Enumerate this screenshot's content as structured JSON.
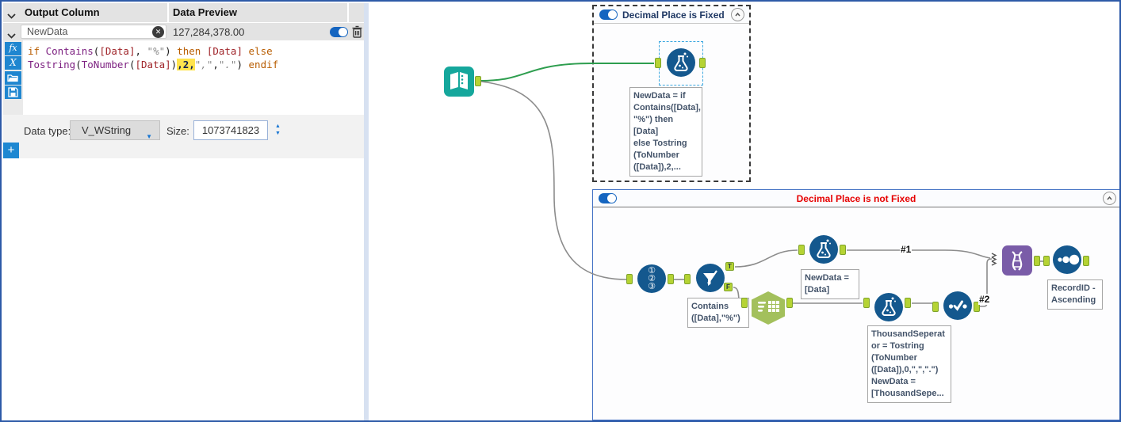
{
  "left_panel": {
    "header": {
      "output_column": "Output Column",
      "data_preview": "Data Preview"
    },
    "field_row": {
      "name": "NewData",
      "preview": "127,284,378.00",
      "clear_glyph": "✕"
    },
    "formula": {
      "line1": [
        {
          "t": "if ",
          "c": "kw"
        },
        {
          "t": "Contains",
          "c": "fn"
        },
        {
          "t": "(",
          "c": "pl"
        },
        {
          "t": "[Data]",
          "c": "fld"
        },
        {
          "t": ", ",
          "c": "pl"
        },
        {
          "t": "\"%\"",
          "c": "str"
        },
        {
          "t": ") ",
          "c": "pl"
        },
        {
          "t": "then",
          "c": "kw"
        },
        {
          "t": " ",
          "c": "pl"
        },
        {
          "t": "[Data]",
          "c": "fld"
        },
        {
          "t": " ",
          "c": "pl"
        },
        {
          "t": "else",
          "c": "kw"
        }
      ],
      "line2": [
        {
          "t": "Tostring",
          "c": "fn"
        },
        {
          "t": "(",
          "c": "pl"
        },
        {
          "t": "ToNumber",
          "c": "fn"
        },
        {
          "t": "(",
          "c": "pl"
        },
        {
          "t": "[Data]",
          "c": "fld"
        },
        {
          "t": ")",
          "c": "pl"
        },
        {
          "t": ",2,",
          "c": "hl"
        },
        {
          "t": "\",\"",
          "c": "str"
        },
        {
          "t": ",",
          "c": "pl"
        },
        {
          "t": "\".\"",
          "c": "str"
        },
        {
          "t": ")",
          "c": "pl"
        },
        {
          "t": " ",
          "c": "pl"
        },
        {
          "t": "endif",
          "c": "kw"
        }
      ]
    },
    "toolbar": {
      "fx_glyph": "fx",
      "x_glyph": "X",
      "add_glyph": "+"
    },
    "footer": {
      "data_type_label": "Data type:",
      "data_type_value": "V_WString",
      "size_label": "Size:",
      "size_value": "1073741823",
      "dropdown_arrow": "▼",
      "spin_up": "▲",
      "spin_down": "▼"
    }
  },
  "canvas": {
    "container_fixed": {
      "title": "Decimal Place is Fixed"
    },
    "container_not_fixed": {
      "title": "Decimal Place is not Fixed"
    },
    "annotations": {
      "formula_fixed": "NewData = if\nContains([Data],\n\"%\") then [Data]\nelse Tostring\n(ToNumber\n([Data]),2,...",
      "filter": "Contains\n([Data],\"%\")",
      "formula_top": "NewData =\n[Data]",
      "formula_bottom": "ThousandSeperat\nor = Tostring\n(ToNumber\n([Data]),0,\",\",\".\")\nNewData =\n[ThousandSepe...",
      "sort": "RecordID -\nAscending"
    },
    "labels": {
      "conn1": "#1",
      "conn2": "#2",
      "filter_true": "T",
      "filter_false": "F"
    },
    "icons": {
      "record_id_glyphs": "①\n②\n③"
    }
  },
  "colors": {
    "window_border": "#2D5AA8",
    "accent_blue": "#1E86D0",
    "toggle_blue": "#1565C0",
    "tool_blue": "#14588E",
    "text_input_teal": "#15A79C",
    "anchor_green": "#B5D334",
    "union_purple": "#7A5CA8",
    "hexagon_green": "#A3C05C",
    "wire_gray": "#8C8C8C",
    "wire_selected_green": "#2E9E4F",
    "title_fixed": "#1F3864",
    "title_not_fixed": "#E60000",
    "highlight_yellow": "#FFE34D"
  }
}
